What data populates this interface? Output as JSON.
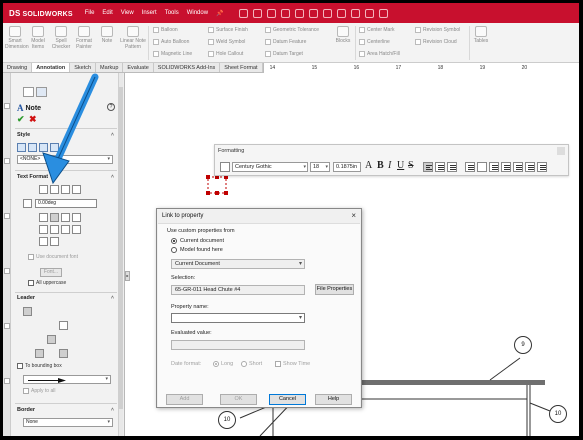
{
  "app": {
    "brand": "SOLIDWORKS",
    "brand_mark": "DS",
    "menu": [
      "File",
      "Edit",
      "View",
      "Insert",
      "Tools",
      "Window"
    ],
    "accent": "#c8102e"
  },
  "ribbon": {
    "big_buttons": [
      {
        "label": "Smart Dimension"
      },
      {
        "label": "Model Items"
      },
      {
        "label": "Spell Checker"
      },
      {
        "label": "Format Painter"
      },
      {
        "label": "Note"
      },
      {
        "label": "Linear Note Pattern"
      }
    ],
    "small_items": [
      "Balloon",
      "Auto Balloon",
      "Magnetic Line",
      "Surface Finish",
      "Weld Symbol",
      "Hole Callout",
      "Geometric Tolerance",
      "Datum Feature",
      "Datum Target",
      "Blocks",
      "Center Mark",
      "Centerline",
      "Area Hatch/Fill",
      "Revision Symbol",
      "Revision Cloud",
      "Tables"
    ]
  },
  "tabs": [
    "Drawing",
    "Annotation",
    "Sketch",
    "Markup",
    "Evaluate",
    "SOLIDWORKS Add-Ins",
    "Sheet Format"
  ],
  "active_tab": "Annotation",
  "ruler": [
    "14",
    "15",
    "16",
    "17",
    "18",
    "19",
    "20"
  ],
  "pm": {
    "title": "Note",
    "style_section": "Style",
    "style_dropdown": "<NONE>",
    "text_format_section": "Text Format",
    "angle_value": "0.00deg",
    "use_document_font": "Use document font",
    "font_button": "Font...",
    "all_uppercase": "All uppercase",
    "leader_section": "Leader",
    "to_bounding_box": "To bounding box",
    "apply_to_all": "Apply to all",
    "border_section": "Border",
    "border_dropdown": "None"
  },
  "formatting": {
    "title": "Formatting",
    "font": "Century Gothic",
    "size": "18",
    "height": "0.1875in",
    "letters": [
      "A",
      "B",
      "I",
      "U",
      "S"
    ]
  },
  "dialog": {
    "title": "Link to property",
    "close": "×",
    "group_label": "Use custom properties from",
    "radio_current": "Current document",
    "radio_model": "Model found here",
    "source_dropdown": "Current Document",
    "selection_label": "Selection:",
    "selection_value": "65-GR-011 Head Chute #4",
    "file_properties_button": "File Properties",
    "property_name_label": "Property name:",
    "property_name_value": "",
    "evaluated_label": "Evaluated value:",
    "evaluated_value": "",
    "date_format_label": "Date format:",
    "date_long": "Long",
    "date_short": "Short",
    "show_time": "Show Time",
    "buttons": {
      "add": "Add",
      "ok": "OK",
      "cancel": "Cancel",
      "help": "Help"
    }
  },
  "drawing": {
    "balloons": [
      "9",
      "10",
      "10"
    ]
  },
  "colors": {
    "arrow": "#2a8ee0",
    "ok": "#2c9a2c",
    "cancel": "#d01010",
    "selection_box": "#c00000"
  }
}
